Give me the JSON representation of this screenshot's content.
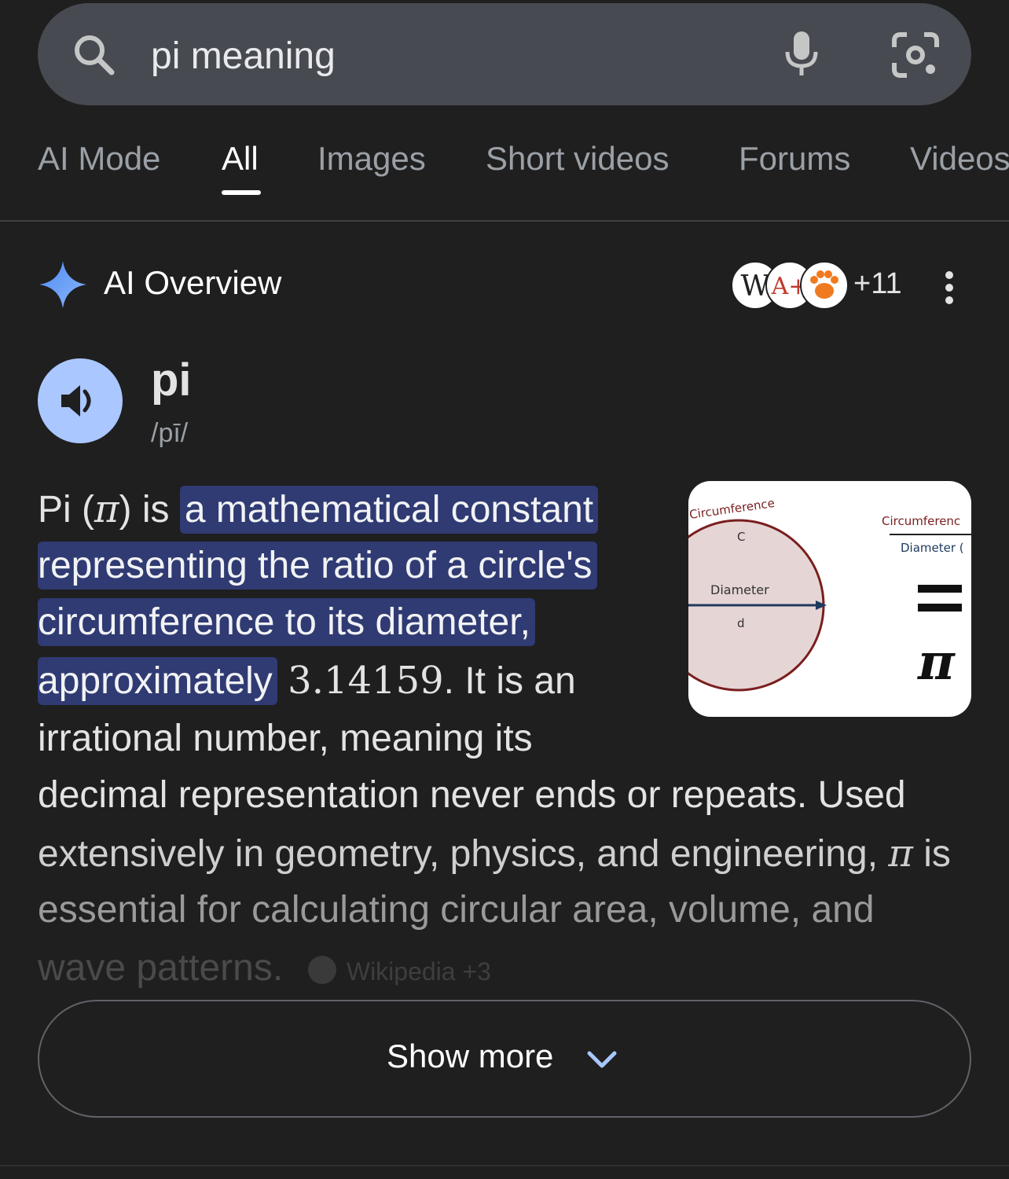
{
  "search": {
    "query": "pi meaning"
  },
  "tabs": [
    {
      "label": "AI Mode"
    },
    {
      "label": "All"
    },
    {
      "label": "Images"
    },
    {
      "label": "Short videos"
    },
    {
      "label": "Forums"
    },
    {
      "label": "Videos"
    }
  ],
  "ai_overview": {
    "title": "AI Overview",
    "sources_more": "+11",
    "source_icons": [
      "wikipedia-icon",
      "a-plus-icon",
      "paw-icon"
    ]
  },
  "pronunciation": {
    "word": "pi",
    "phonetic": "/pī/"
  },
  "body": {
    "l1_pre": "Pi (",
    "pi_symbol": "π",
    "l1_mid": ") is ",
    "l1_hl": "a mathematical constant",
    "l2_hl": "representing the ratio of a circle's",
    "l3_hl": "circumference to its diameter,",
    "l4_hl": "approximately",
    "value": "3.14159",
    "l4_post": ". It is an",
    "l5": "irrational number, meaning its",
    "l6": "decimal representation never ends or repeats. Used",
    "l7_pre": "extensively in geometry, physics, and engineering, ",
    "l7_post": " is",
    "l8": "essential for calculating circular area, volume, and",
    "l9": "wave patterns.",
    "citation": "Wikipedia +3"
  },
  "diagram": {
    "circumference_arc": "Circumference",
    "c_label": "C",
    "diameter_label": "Diameter",
    "d_label": "d",
    "fraction_top": "Circumferenc",
    "fraction_bottom": "Diameter (",
    "equals": "=",
    "pi": "π"
  },
  "show_more": {
    "label": "Show more"
  },
  "colors": {
    "background": "#1f1f1f",
    "search_bg": "#474a50",
    "highlight": "#303a73",
    "accent": "#aac7ff"
  }
}
